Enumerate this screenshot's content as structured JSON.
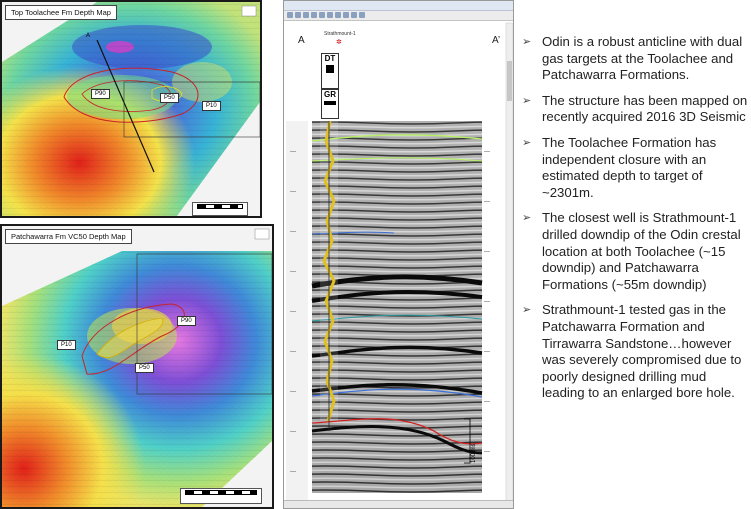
{
  "map_top": {
    "title": "Top Toolachee Fm Depth Map",
    "labels": {
      "a": "A",
      "p90": "P90",
      "p50": "P50",
      "p10": "P10"
    }
  },
  "map_bottom": {
    "title": "Patchawarra Fm VC50 Depth Map",
    "labels": {
      "p90": "P90",
      "p10": "P10",
      "p50": "P50"
    }
  },
  "seismic": {
    "section_start": "A",
    "section_end": "A’",
    "well": "Strathmount-1",
    "logs": {
      "dt": "DT",
      "gr": "GR"
    },
    "scale_label": "100 ms"
  },
  "bullets": [
    "Odin is a robust anticline with dual gas targets at the Toolachee  and Patchawarra Formations.",
    "The structure has been mapped on recently acquired 2016 3D Seismic",
    "The Toolachee Formation has independent closure with an estimated depth to target of ~2301m.",
    "The closest well is Strathmount-1 drilled downdip of the Odin crestal location at both Toolachee (~15 downdip) and Patchawarra Formations (~55m downdip)",
    "Strathmount-1 tested gas in the Patchawarra Formation and Tirrawarra Sandstone…however was severely compromised due to poorly designed drilling mud leading to an enlarged bore hole."
  ],
  "colors": {
    "bullet_text": "#222222",
    "horizon_green": "#b7f064",
    "horizon_blue": "#3a6fd8",
    "horizon_red": "#d42020"
  }
}
